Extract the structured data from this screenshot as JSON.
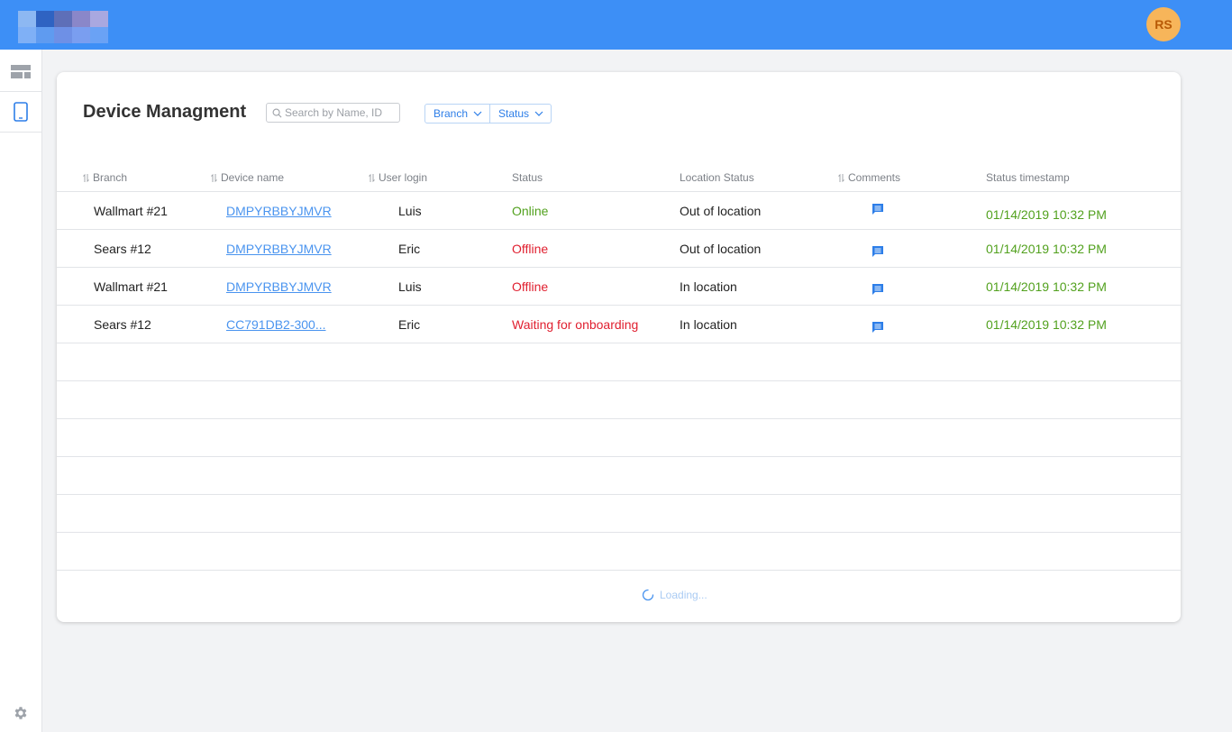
{
  "header": {
    "user_initials": "RS"
  },
  "sidebar": {
    "items": [
      {
        "icon": "dashboard-icon",
        "active": false
      },
      {
        "icon": "tablet-icon",
        "active": true
      }
    ],
    "footer_icon": "gear-icon"
  },
  "page": {
    "title": "Device Managment",
    "search_placeholder": "Search by Name, ID",
    "filters": [
      {
        "label": "Branch"
      },
      {
        "label": "Status"
      }
    ]
  },
  "table": {
    "columns": [
      {
        "label": "Branch",
        "sortable": true
      },
      {
        "label": "Device name",
        "sortable": true
      },
      {
        "label": "User login",
        "sortable": true
      },
      {
        "label": "Status",
        "sortable": false
      },
      {
        "label": "Location Status",
        "sortable": false
      },
      {
        "label": "Comments",
        "sortable": true
      },
      {
        "label": "Status timestamp",
        "sortable": false
      }
    ],
    "rows": [
      {
        "branch": "Wallmart #21",
        "device": "DMPYRBBYJMVR",
        "user": "Luis",
        "status": "Online",
        "location": "Out of location",
        "timestamp": "01/14/2019 10:32 PM"
      },
      {
        "branch": "Sears #12",
        "device": "DMPYRBBYJMVR",
        "user": "Eric",
        "status": "Offline",
        "location": "Out of location",
        "timestamp": "01/14/2019 10:32 PM"
      },
      {
        "branch": "Wallmart #21",
        "device": "DMPYRBBYJMVR",
        "user": "Luis",
        "status": "Offline",
        "location": "In location",
        "timestamp": "01/14/2019 10:32 PM"
      },
      {
        "branch": "Sears #12",
        "device": "CC791DB2-300...",
        "user": "Eric",
        "status": "Waiting for onboarding",
        "location": "In location",
        "timestamp": "01/14/2019 10:32 PM"
      }
    ],
    "loading_text": "Loading..."
  },
  "colors": {
    "topbar": "#3d8ff6",
    "avatar": "#f7b55a",
    "link": "#4a94ef",
    "status_online": "#52a11e",
    "status_offline": "#e01f2f",
    "timestamp": "#52a11e"
  }
}
